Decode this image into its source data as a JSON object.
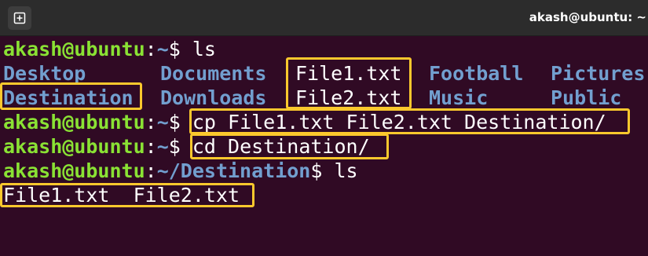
{
  "window": {
    "title": "akash@ubuntu: ~",
    "new_tab_icon": "new-tab-icon"
  },
  "colors": {
    "background": "#300a24",
    "prompt_user": "#8ae234",
    "prompt_path": "#729fcf",
    "directory": "#729fcf",
    "highlight": "#fbc82d"
  },
  "terminal": {
    "prompt_user": "akash@ubuntu",
    "prompt_sep": ":",
    "home_path": "~",
    "dest_path": "~/Destination",
    "prompt_end": "$ ",
    "line1": {
      "command": "ls"
    },
    "ls_output": {
      "row1": [
        "Desktop",
        "Documents",
        "File1.txt",
        "Football",
        "Pictures"
      ],
      "row2": [
        "Destination",
        "Downloads",
        "File2.txt",
        "Music",
        "Public"
      ]
    },
    "line4": {
      "command": "cp File1.txt File2.txt Destination/"
    },
    "line5": {
      "command": "cd Destination/"
    },
    "line6": {
      "command": "ls"
    },
    "final_output": "File1.txt  File2.txt"
  }
}
